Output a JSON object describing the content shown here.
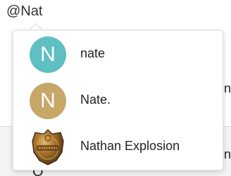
{
  "composer": {
    "text": "@Nat"
  },
  "mention_suggestions": [
    {
      "name": "nate",
      "avatar_letter": "N",
      "avatar_color": "#5fbfc2"
    },
    {
      "name": "Nate.",
      "avatar_letter": "N",
      "avatar_color": "#c6a767"
    },
    {
      "name": "Nathan Explosion",
      "avatar_icon": "bronze-shield-badge-icon"
    }
  ],
  "colors": {
    "popover_bg": "#ffffff",
    "popover_border": "#e2e2e2",
    "text": "#222222"
  }
}
